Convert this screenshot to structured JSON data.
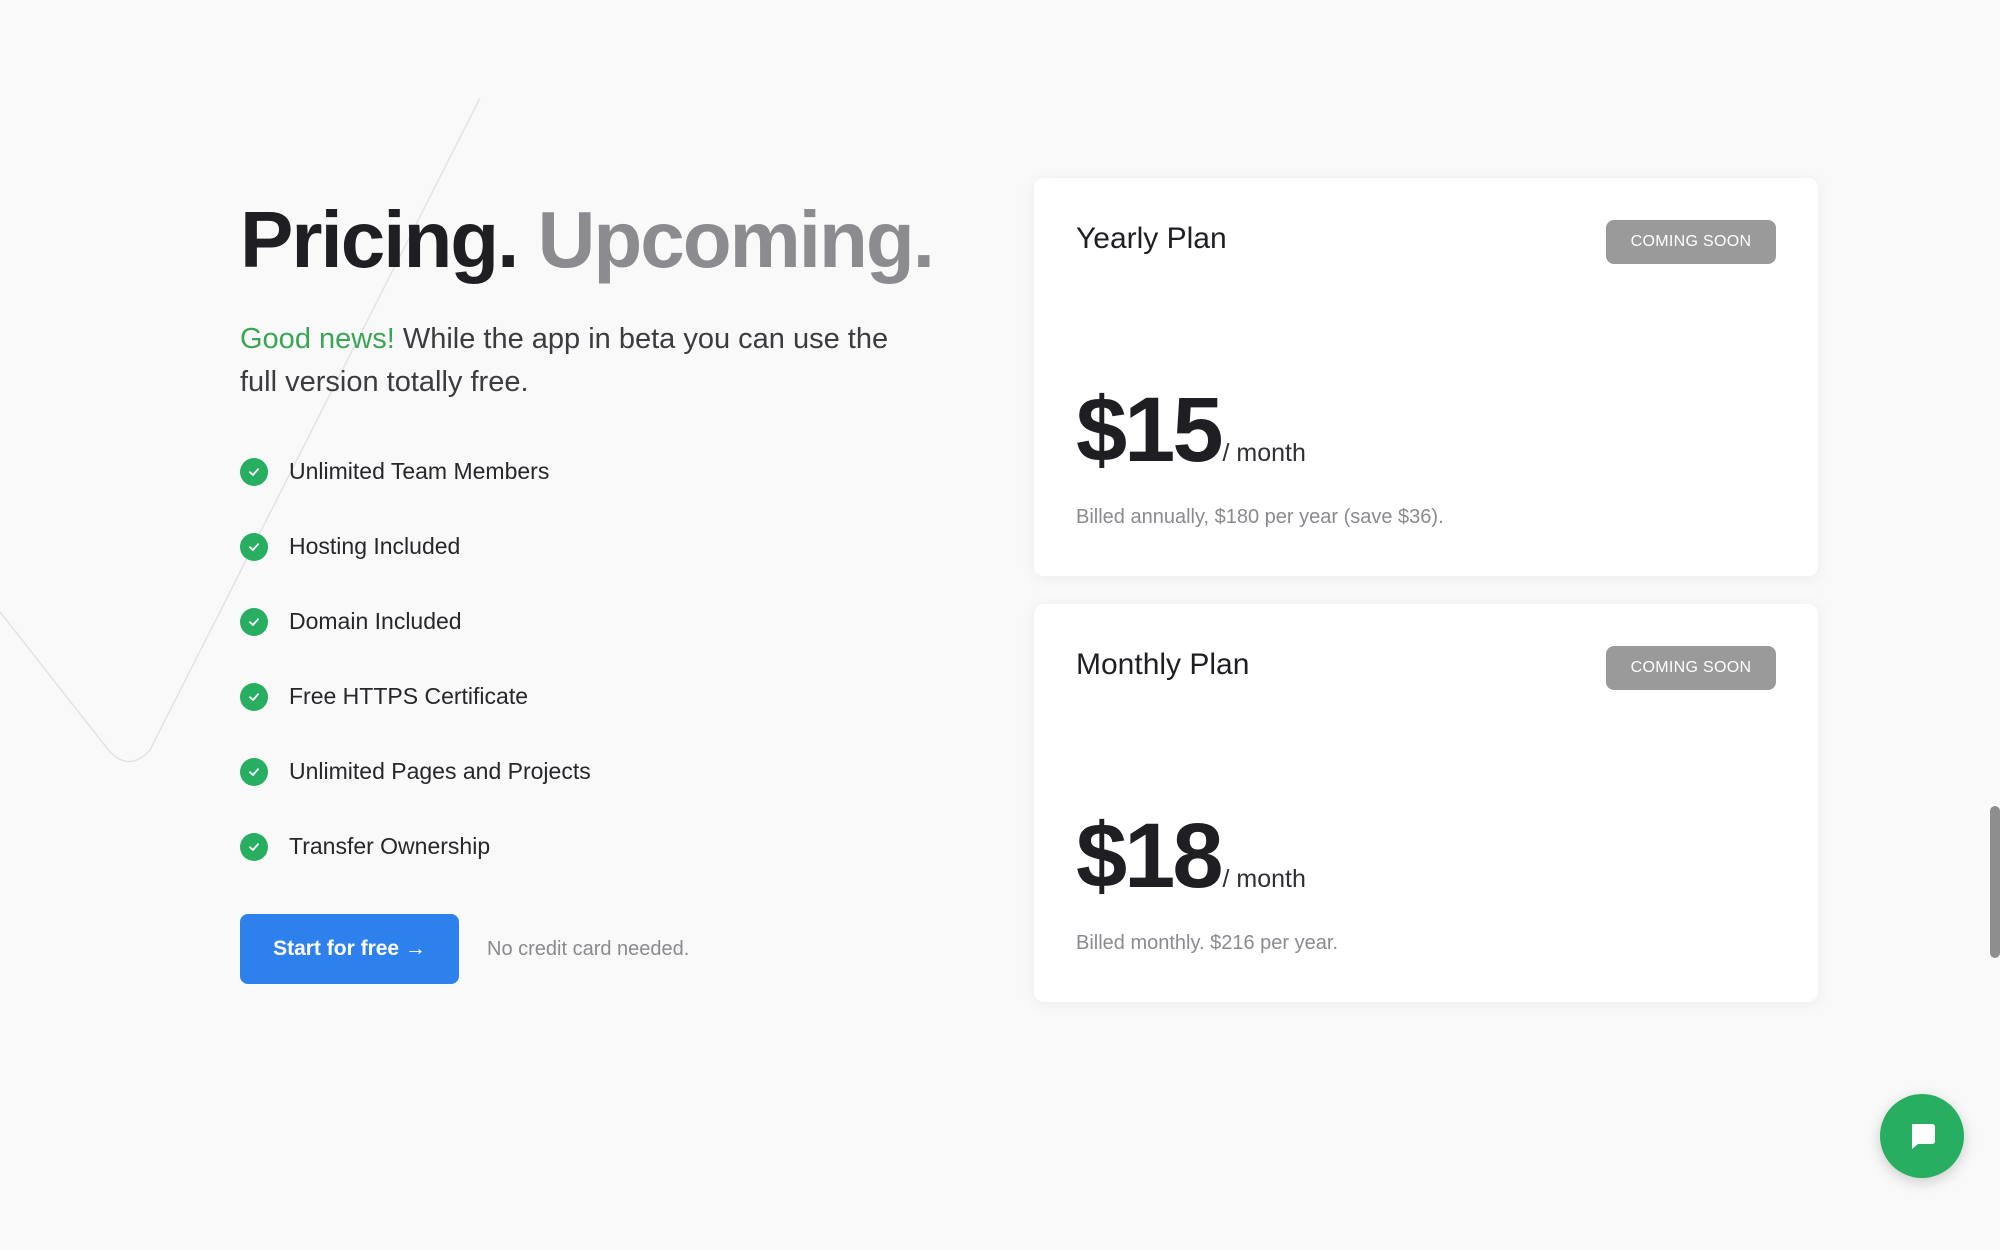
{
  "hero": {
    "title_primary": "Pricing.",
    "title_secondary": "Upcoming.",
    "intro_highlight": "Good news!",
    "intro_text": " While the app in beta you can use the full version totally free."
  },
  "features": [
    "Unlimited Team Members",
    "Hosting Included",
    "Domain Included",
    "Free HTTPS Certificate",
    "Unlimited Pages and Projects",
    "Transfer Ownership"
  ],
  "cta": {
    "label": "Start for free →",
    "note": "No credit card needed."
  },
  "plans": [
    {
      "name": "Yearly Plan",
      "badge": "COMING SOON",
      "price": "$15",
      "period": "/ month",
      "billing": "Billed annually, $180 per year (save $36)."
    },
    {
      "name": "Monthly Plan",
      "badge": "COMING SOON",
      "price": "$18",
      "period": "/ month",
      "billing": "Billed monthly. $216 per year."
    }
  ],
  "colors": {
    "accent_blue": "#2e80ec",
    "success_green": "#27ae60",
    "badge_gray": "#9a9a9a",
    "background": "#f9f9f9"
  },
  "icons": {
    "feature": "check-circle-icon",
    "chat": "chat-bubble-icon"
  }
}
